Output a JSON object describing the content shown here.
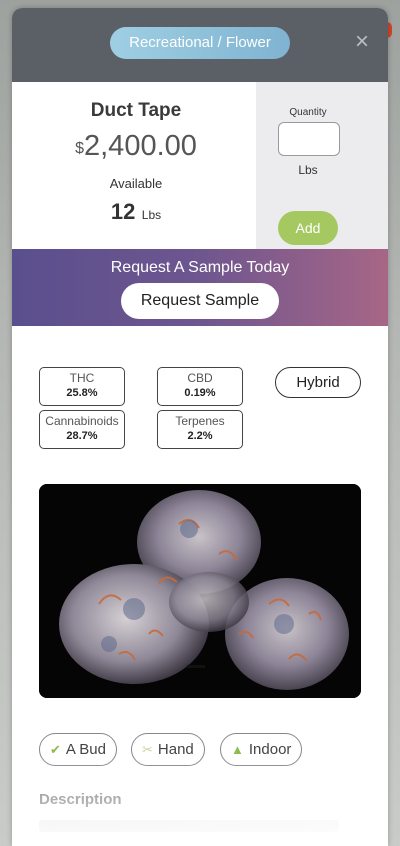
{
  "header": {
    "category": "Recreational / Flower",
    "close_symbol": "×"
  },
  "product": {
    "name": "Duct Tape",
    "currency": "$",
    "price": "2,400.00",
    "available_label": "Available",
    "available_value": "12",
    "available_unit": "Lbs"
  },
  "order": {
    "quantity_label": "Quantity",
    "quantity_value": "",
    "quantity_unit": "Lbs",
    "add_label": "Add"
  },
  "sample": {
    "title": "Request A Sample Today",
    "button_label": "Request Sample"
  },
  "stats": [
    {
      "label": "THC",
      "value": "25.8%"
    },
    {
      "label": "CBD",
      "value": "0.19%"
    },
    {
      "label": "Cannabinoids",
      "value": "28.7%"
    },
    {
      "label": "Terpenes",
      "value": "2.2%"
    }
  ],
  "strain_type": "Hybrid",
  "tags": [
    {
      "label": "A Bud",
      "icon": "check-icon",
      "color": "#8bbd4a"
    },
    {
      "label": "Hand",
      "icon": "scissors-icon",
      "color": "#c9d39a"
    },
    {
      "label": "Indoor",
      "icon": "tree-icon",
      "color": "#8bbd4a"
    }
  ],
  "description_title": "Description",
  "colors": {
    "header_bg": "#5b5f66",
    "category_pill": "#8fc3dc",
    "add_button": "#a5c860",
    "sample_gradient_start": "#5a4f8e",
    "sample_gradient_end": "#a76686"
  }
}
